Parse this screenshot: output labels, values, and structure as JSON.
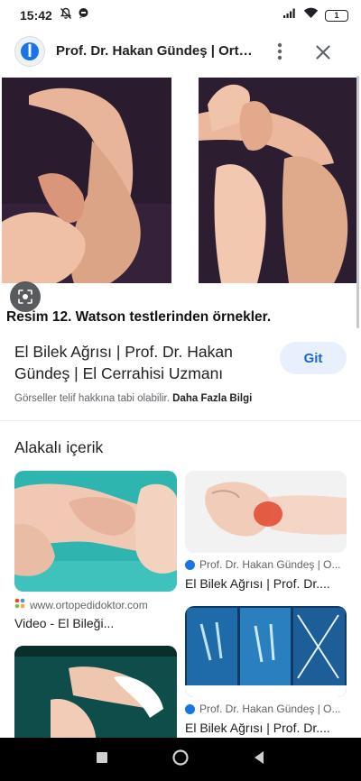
{
  "status_bar": {
    "time": "15:42",
    "battery": "1",
    "icons": [
      "mute-icon",
      "chat-icon",
      "signal-icon",
      "wifi-icon",
      "battery-icon"
    ]
  },
  "header": {
    "title": "Prof. Dr. Hakan Gündeş | Ortop...",
    "logo_icon": "site-logo-icon",
    "more_icon": "more-vert-icon",
    "close_icon": "close-icon"
  },
  "main_image": {
    "caption": "Resim 12. Watson testlerinden örnekler.",
    "lens_icon": "lens-icon"
  },
  "result": {
    "title": "El Bilek Ağrısı | Prof. Dr. Hakan Gündeş | El Cerrahisi Uzmanı",
    "go_label": "Git",
    "copyright_text": "Görseller telif hakkına tabi olabilir.",
    "more_info": "Daha Fazla Bilgi"
  },
  "related": {
    "heading": "Alakalı içerik",
    "cards": [
      {
        "source": "www.ortopedidoktor.com",
        "title": "Video - El Bileği..."
      },
      {
        "source": "Prof. Dr. Hakan Gündeş | O...",
        "title": "El Bilek Ağrısı | Prof. Dr...."
      },
      {
        "source": "Prof. Dr. Hakan Gündeş | O...",
        "title": "El Bilek Ağrısı | Prof. Dr...."
      },
      {
        "source": "",
        "title": ""
      }
    ]
  },
  "colors": {
    "accent": "#1967d2",
    "go_button_bg": "#e8f0fe",
    "nav_bar": "#000000"
  }
}
